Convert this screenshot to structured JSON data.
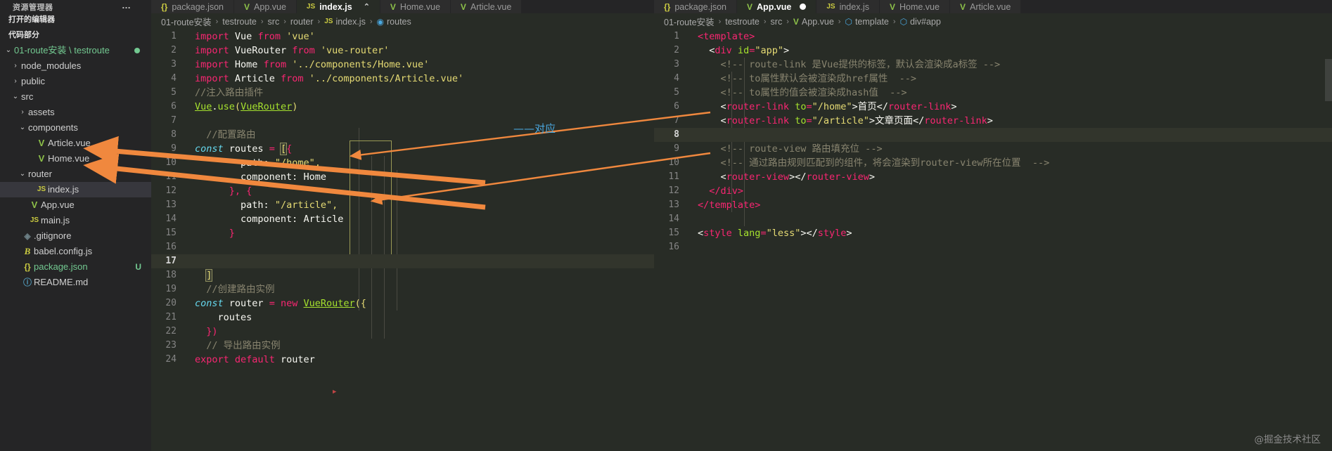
{
  "sidebar": {
    "title": "资源管理器",
    "overflow_dots": "…",
    "sections": [
      {
        "label": "打开的编辑器"
      },
      {
        "label": "代码部分"
      }
    ],
    "tree": [
      {
        "twisty": "⌄",
        "icon": "",
        "label": "01-route安装 \\ testroute",
        "kind": "root",
        "indent": 0,
        "selected": false,
        "badge": "",
        "dot": true
      },
      {
        "twisty": "›",
        "icon": "",
        "label": "node_modules",
        "kind": "folder",
        "indent": 1,
        "selected": false,
        "badge": "",
        "dot": false
      },
      {
        "twisty": "›",
        "icon": "",
        "label": "public",
        "kind": "folder",
        "indent": 1,
        "selected": false,
        "badge": "",
        "dot": false
      },
      {
        "twisty": "⌄",
        "icon": "",
        "label": "src",
        "kind": "folder",
        "indent": 1,
        "selected": false,
        "badge": "",
        "dot": false
      },
      {
        "twisty": "›",
        "icon": "",
        "label": "assets",
        "kind": "folder",
        "indent": 2,
        "selected": false,
        "badge": "",
        "dot": false
      },
      {
        "twisty": "⌄",
        "icon": "",
        "label": "components",
        "kind": "folder",
        "indent": 2,
        "selected": false,
        "badge": "",
        "dot": false
      },
      {
        "twisty": "",
        "icon": "V",
        "label": "Article.vue",
        "kind": "vue",
        "indent": 3,
        "selected": false,
        "badge": "",
        "dot": false
      },
      {
        "twisty": "",
        "icon": "V",
        "label": "Home.vue",
        "kind": "vue",
        "indent": 3,
        "selected": false,
        "badge": "",
        "dot": false
      },
      {
        "twisty": "⌄",
        "icon": "",
        "label": "router",
        "kind": "folder",
        "indent": 2,
        "selected": false,
        "badge": "",
        "dot": false
      },
      {
        "twisty": "",
        "icon": "JS",
        "label": "index.js",
        "kind": "js",
        "indent": 3,
        "selected": true,
        "badge": "",
        "dot": false
      },
      {
        "twisty": "",
        "icon": "V",
        "label": "App.vue",
        "kind": "vue",
        "indent": 2,
        "selected": false,
        "badge": "",
        "dot": false
      },
      {
        "twisty": "",
        "icon": "JS",
        "label": "main.js",
        "kind": "js",
        "indent": 2,
        "selected": false,
        "badge": "",
        "dot": false
      },
      {
        "twisty": "",
        "icon": "◈",
        "label": ".gitignore",
        "kind": "git",
        "indent": 1,
        "selected": false,
        "badge": "",
        "dot": false
      },
      {
        "twisty": "",
        "icon": "B",
        "label": "babel.config.js",
        "kind": "babel",
        "indent": 1,
        "selected": false,
        "badge": "",
        "dot": false
      },
      {
        "twisty": "",
        "icon": "{}",
        "label": "package.json",
        "kind": "json",
        "indent": 1,
        "selected": false,
        "badge": "U",
        "dot": false
      },
      {
        "twisty": "",
        "icon": "ⓘ",
        "label": "README.md",
        "kind": "md",
        "indent": 1,
        "selected": false,
        "badge": "",
        "dot": false
      }
    ]
  },
  "left_group": {
    "tabs": [
      {
        "icon": "{}",
        "icon_kind": "json",
        "label": "package.json",
        "active": false,
        "dirty": false,
        "close": ""
      },
      {
        "icon": "V",
        "icon_kind": "vue",
        "label": "App.vue",
        "active": false,
        "dirty": false,
        "close": ""
      },
      {
        "icon": "JS",
        "icon_kind": "js",
        "label": "index.js",
        "active": true,
        "dirty": false,
        "close": "⌃"
      },
      {
        "icon": "V",
        "icon_kind": "vue",
        "label": "Home.vue",
        "active": false,
        "dirty": false,
        "close": ""
      },
      {
        "icon": "V",
        "icon_kind": "vue",
        "label": "Article.vue",
        "active": false,
        "dirty": false,
        "close": ""
      }
    ],
    "breadcrumb": [
      {
        "icon": "",
        "icon_kind": "",
        "label": "01-route安装"
      },
      {
        "icon": "",
        "icon_kind": "",
        "label": "testroute"
      },
      {
        "icon": "",
        "icon_kind": "",
        "label": "src"
      },
      {
        "icon": "",
        "icon_kind": "",
        "label": "router"
      },
      {
        "icon": "JS",
        "icon_kind": "js",
        "label": "index.js"
      },
      {
        "icon": "◉",
        "icon_kind": "sym",
        "label": "routes"
      }
    ],
    "separator": "›",
    "lines": [
      {
        "n": "1",
        "decor": "none",
        "hl": false
      },
      {
        "n": "2",
        "decor": "none",
        "hl": false
      },
      {
        "n": "3",
        "decor": "blue",
        "hl": false
      },
      {
        "n": "4",
        "decor": "blue",
        "hl": false
      },
      {
        "n": "5",
        "decor": "blue",
        "hl": false
      },
      {
        "n": "6",
        "decor": "blue",
        "hl": false
      },
      {
        "n": "7",
        "decor": "none",
        "hl": false
      },
      {
        "n": "8",
        "decor": "blue",
        "hl": false
      },
      {
        "n": "9",
        "decor": "blue",
        "hl": false
      },
      {
        "n": "10",
        "decor": "blue",
        "hl": false
      },
      {
        "n": "11",
        "decor": "blue",
        "hl": false
      },
      {
        "n": "12",
        "decor": "blue",
        "hl": false
      },
      {
        "n": "13",
        "decor": "blue",
        "hl": false
      },
      {
        "n": "14",
        "decor": "blue",
        "hl": false
      },
      {
        "n": "15",
        "decor": "blue",
        "hl": false
      },
      {
        "n": "16",
        "decor": "green",
        "hl": false
      },
      {
        "n": "17",
        "decor": "green",
        "hl": true
      },
      {
        "n": "18",
        "decor": "blue",
        "hl": false
      },
      {
        "n": "19",
        "decor": "blue",
        "hl": false
      },
      {
        "n": "20",
        "decor": "blue",
        "hl": false
      },
      {
        "n": "21",
        "decor": "blue",
        "hl": false
      },
      {
        "n": "22",
        "decor": "blue",
        "hl": false
      },
      {
        "n": "23",
        "decor": "blue",
        "hl": false
      },
      {
        "n": "24",
        "decor": "none",
        "hl": false
      }
    ],
    "code": {
      "l1_kw": "import",
      "l1_name": "Vue",
      "l1_from": "from",
      "l1_str": "'vue'",
      "l2_kw": "import",
      "l2_name": "VueRouter",
      "l2_from": "from",
      "l2_str": "'vue-router'",
      "l3_kw": "import",
      "l3_name": "Home",
      "l3_from": "from",
      "l3_str": "'../components/Home.vue'",
      "l4_kw": "import",
      "l4_name": "Article",
      "l4_from": "from",
      "l4_str": "'../components/Article.vue'",
      "l5_cmt": "//注入路由插件",
      "l6_obj": "Vue",
      "l6_dot": ".",
      "l6_fn": "use",
      "l6_open": "(",
      "l6_arg": "VueRouter",
      "l6_close": ")",
      "l8_cmt": "//配置路由",
      "l9_kw": "const",
      "l9_name": "routes",
      "l9_eq": "=",
      "l9_brk": "[",
      "l9_brace": "{",
      "l10_key": "path:",
      "l10_val": "\"/home\",",
      "l11_key": "component:",
      "l11_val": "Home",
      "l12_txt": "}, {",
      "l13_key": "path:",
      "l13_val": "\"/article\",",
      "l14_key": "component:",
      "l14_val": "Article",
      "l15_txt": "}",
      "l18_txt": "]",
      "l19_cmt": "//创建路由实例",
      "l20_kw": "const",
      "l20_name": "router",
      "l20_eq": "=",
      "l20_new": "new",
      "l20_cls": "VueRouter",
      "l20_open": "({",
      "l21_txt": "routes",
      "l22_txt": "})",
      "l23_cmt": "// 导出路由实例",
      "l24_kw1": "export",
      "l24_kw2": "default",
      "l24_name": "router"
    }
  },
  "right_group": {
    "tabs": [
      {
        "icon": "{}",
        "icon_kind": "json",
        "label": "package.json",
        "active": false,
        "dirty": false
      },
      {
        "icon": "V",
        "icon_kind": "vue",
        "label": "App.vue",
        "active": true,
        "dirty": true
      },
      {
        "icon": "JS",
        "icon_kind": "js",
        "label": "index.js",
        "active": false,
        "dirty": false
      },
      {
        "icon": "V",
        "icon_kind": "vue",
        "label": "Home.vue",
        "active": false,
        "dirty": false
      },
      {
        "icon": "V",
        "icon_kind": "vue",
        "label": "Article.vue",
        "active": false,
        "dirty": false
      }
    ],
    "breadcrumb": [
      {
        "icon": "",
        "icon_kind": "",
        "label": "01-route安装"
      },
      {
        "icon": "",
        "icon_kind": "",
        "label": "testroute"
      },
      {
        "icon": "",
        "icon_kind": "",
        "label": "src"
      },
      {
        "icon": "V",
        "icon_kind": "vue",
        "label": "App.vue"
      },
      {
        "icon": "⬡",
        "icon_kind": "sym",
        "label": "template"
      },
      {
        "icon": "⬡",
        "icon_kind": "sym",
        "label": "div#app"
      }
    ],
    "separator": "›",
    "lines": [
      {
        "n": "1",
        "decor": "none",
        "hl": false
      },
      {
        "n": "2",
        "decor": "none",
        "hl": false
      },
      {
        "n": "3",
        "decor": "blue",
        "hl": false
      },
      {
        "n": "4",
        "decor": "blue",
        "hl": false
      },
      {
        "n": "5",
        "decor": "blue",
        "hl": false
      },
      {
        "n": "6",
        "decor": "blue",
        "hl": false
      },
      {
        "n": "7",
        "decor": "blue",
        "hl": false
      },
      {
        "n": "8",
        "decor": "blue",
        "hl": true
      },
      {
        "n": "9",
        "decor": "blue",
        "hl": false
      },
      {
        "n": "10",
        "decor": "blue",
        "hl": false
      },
      {
        "n": "11",
        "decor": "blue",
        "hl": false
      },
      {
        "n": "12",
        "decor": "blue",
        "hl": false
      },
      {
        "n": "13",
        "decor": "none",
        "hl": false
      },
      {
        "n": "14",
        "decor": "none",
        "hl": false
      },
      {
        "n": "15",
        "decor": "none",
        "hl": false
      },
      {
        "n": "16",
        "decor": "none",
        "hl": false
      }
    ],
    "code": {
      "r1": "<template>",
      "r2_open": "<",
      "r2_tag": "div",
      "r2_attr": "id",
      "r2_eq": "=",
      "r2_val": "\"app\"",
      "r2_close": ">",
      "r3_cmt": "<!-- route-link 是Vue提供的标签，默认会渲染成a标签 -->",
      "r4_cmt": "<!-- to属性默认会被渲染成href属性  -->",
      "r5_cmt": "<!-- to属性的值会被渲染成hash值  -->",
      "r6_open": "<",
      "r6_tag": "router-link",
      "r6_attr": "to",
      "r6_eq": "=",
      "r6_val": "\"/home\"",
      "r6_gt": ">",
      "r6_text": "首页",
      "r6_endopen": "</",
      "r6_endtag": "router-link",
      "r6_endgt": ">",
      "r7_open": "<",
      "r7_tag": "router-link",
      "r7_attr": "to",
      "r7_eq": "=",
      "r7_val": "\"/article\"",
      "r7_gt": ">",
      "r7_text": "文章页面",
      "r7_endopen": "</",
      "r7_endtag": "router-link",
      "r7_endgt": ">",
      "r9_cmt": "<!-- route-view 路由填充位 -->",
      "r10_cmt": "<!-- 通过路由规则匹配到的组件，将会渲染到router-view所在位置  -->",
      "r11_open": "<",
      "r11_tag": "router-view",
      "r11_gt": ">",
      "r11_endopen": "</",
      "r11_endtag": "router-view",
      "r11_endgt": ">",
      "r12": "</div>",
      "r13": "</template>",
      "r15_open": "<",
      "r15_tag": "style",
      "r15_attr": "lang",
      "r15_eq": "=",
      "r15_val": "\"less\"",
      "r15_gt": ">",
      "r15_endopen": "</",
      "r15_endtag": "style",
      "r15_endgt": ">"
    }
  },
  "annotations": {
    "correspond_label": "——对应",
    "watermark": "@掘金技术社区",
    "arrow_color": "#f0883e"
  }
}
